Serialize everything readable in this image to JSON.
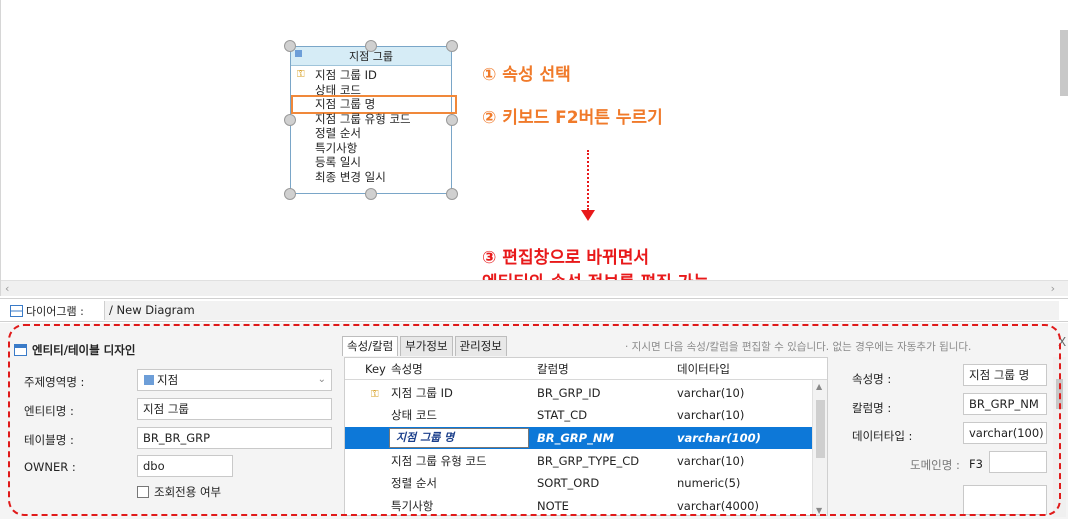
{
  "canvas": {
    "entity": {
      "title": "지점 그룹",
      "attributes": [
        {
          "name": "지점 그룹 ID",
          "is_key": true
        },
        {
          "name": "상태 코드",
          "is_key": false
        },
        {
          "name": "지점 그룹 명",
          "is_key": false,
          "selected": true
        },
        {
          "name": "지점 그룹 유형 코드",
          "is_key": false
        },
        {
          "name": "정렬 순서",
          "is_key": false
        },
        {
          "name": "특기사항",
          "is_key": false
        },
        {
          "name": "등록 일시",
          "is_key": false
        },
        {
          "name": "최종 변경 일시",
          "is_key": false
        }
      ]
    },
    "annotations": {
      "step1": "① 속성 선택",
      "step2": "② 키보드 F2버튼 누르기",
      "step3_line1": "③ 편집창으로 바뀌면서",
      "step3_line2": "엔티티와 속성 정보를 편집 가능"
    },
    "colors": {
      "orange": "#f07a2a",
      "red": "#e8191a"
    }
  },
  "tabstrip": {
    "diagram_tab_label": "다이어그램 :",
    "diagram_path": "/ New Diagram"
  },
  "design": {
    "title": "엔티티/테이블 디자인",
    "fields": {
      "subject_area_label": "주제영역명 :",
      "subject_area_value": "지점",
      "entity_name_label": "엔티티명 :",
      "entity_name_value": "지점 그룹",
      "table_name_label": "테이블명 :",
      "table_name_value": "BR_BR_GRP",
      "owner_label": "OWNER :",
      "owner_value": "dbo",
      "readonly_label": "조회전용 여부"
    },
    "tabs": [
      "속성/칼럼",
      "부가정보",
      "관리정보"
    ],
    "hint": "· 지시면 다음 속성/칼럼을 편집할 수 있습니다. 없는 경우에는 자동추가 됩니다.",
    "columns": {
      "key": "Key",
      "attr": "속성명",
      "col": "칼럼명",
      "type": "데이터타입"
    },
    "rows": [
      {
        "key": true,
        "attr": "지점 그룹 ID",
        "col": "BR_GRP_ID",
        "type": "varchar(10)"
      },
      {
        "key": false,
        "attr": "상태 코드",
        "col": "STAT_CD",
        "type": "varchar(10)"
      },
      {
        "key": false,
        "attr": "지점 그룹 명",
        "col": "BR_GRP_NM",
        "type": "varchar(100)",
        "editing": true
      },
      {
        "key": false,
        "attr": "지점 그룹 유형 코드",
        "col": "BR_GRP_TYPE_CD",
        "type": "varchar(10)"
      },
      {
        "key": false,
        "attr": "정렬 순서",
        "col": "SORT_ORD",
        "type": "numeric(5)"
      },
      {
        "key": false,
        "attr": "특기사항",
        "col": "NOTE",
        "type": "varchar(4000)"
      }
    ],
    "props": {
      "attr_label": "속성명 :",
      "attr_value": "지점 그룹 명",
      "col_label": "칼럼명 :",
      "col_value": "BR_GRP_NM",
      "type_label": "데이터타입 :",
      "type_value": "varchar(100)",
      "domain_label": "도메인명 :",
      "domain_key": "F3",
      "domain_value": ""
    },
    "close_label": "X",
    "accent": "#0d78d8"
  }
}
